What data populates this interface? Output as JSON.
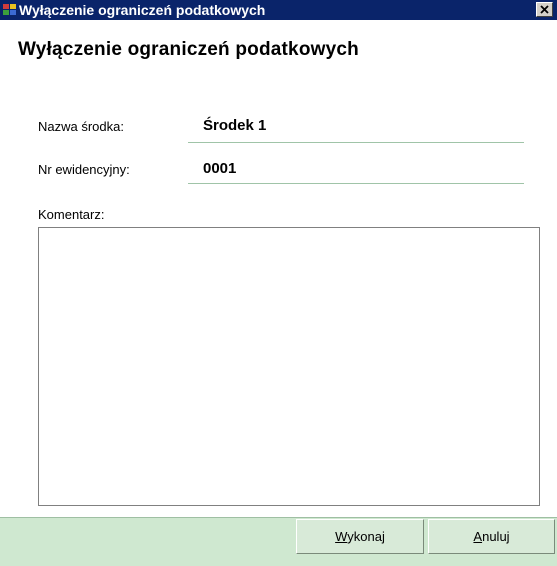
{
  "window": {
    "title": "Wyłączenie ograniczeń podatkowych",
    "close_label": "Close"
  },
  "form": {
    "header": "Wyłączenie ograniczeń podatkowych",
    "fields": [
      {
        "label": "Nazwa środka:",
        "value": "Środek 1"
      },
      {
        "label": "Nr ewidencyjny:",
        "value": "0001"
      }
    ],
    "comment_label": "Komentarz:",
    "comment_value": ""
  },
  "buttons": {
    "execute": {
      "mnemonic": "W",
      "rest": "ykonaj"
    },
    "cancel": {
      "mnemonic": "A",
      "rest": "nuluj"
    }
  },
  "colors": {
    "titlebar": "#0a246a",
    "footer": "#cfe8d0",
    "field_underline": "#a0c4a8"
  },
  "icons": [
    "app-icon",
    "close-icon"
  ]
}
